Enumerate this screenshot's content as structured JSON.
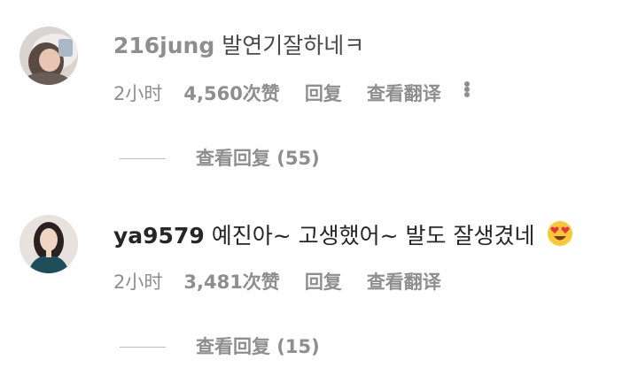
{
  "comments": [
    {
      "username": "216jung",
      "text": "발연기잘하네ㅋ",
      "time": "2小时",
      "likes": "4,560次赞",
      "reply": "回复",
      "translate": "查看翻译",
      "more_icon": "more-dots-icon",
      "view_replies": "查看回复 (55)"
    },
    {
      "username": "ya9579",
      "text": "예진아~ 고생했어~ 발도 잘생겼네",
      "emoji": "heart-eyes-emoji",
      "time": "2小时",
      "likes": "3,481次赞",
      "reply": "回复",
      "translate": "查看翻译",
      "view_replies": "查看回复 (15)"
    }
  ],
  "colors": {
    "text": "#262626",
    "secondary": "#8e8e8e",
    "emoji_yellow": "#f8c83a",
    "heart_red": "#e8323c"
  }
}
